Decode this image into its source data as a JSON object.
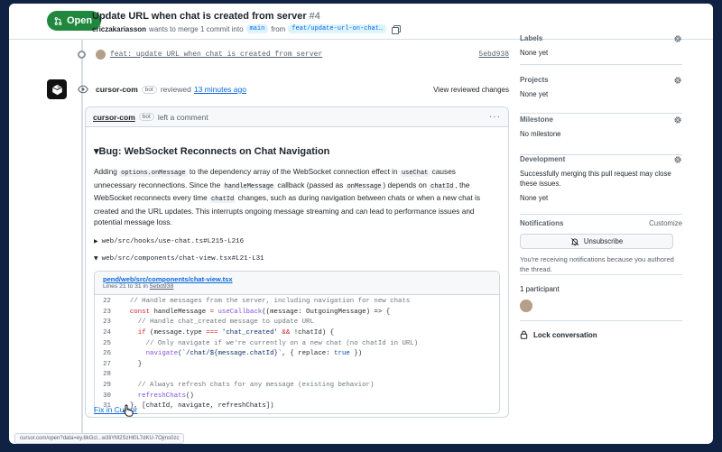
{
  "header": {
    "status_label": "Open",
    "title": "Update URL when chat is created from server",
    "number": "#4",
    "author": "ericzakariasson",
    "merge_text": "wants to merge 1 commit into",
    "base_branch": "main",
    "from_text": "from",
    "head_branch": "feat/update-url-on-chat…"
  },
  "timeline": {
    "commit": {
      "message": "feat: update URL when chat is created from server",
      "sha": "5ebd938"
    },
    "review": {
      "author": "cursor-com",
      "bot_tag": "bot",
      "action": "reviewed",
      "time": "13 minutes ago",
      "view_reviewed": "View reviewed changes"
    }
  },
  "comment": {
    "author": "cursor-com",
    "bot_tag": "bot",
    "action": "left a comment",
    "menu": "···",
    "bug_title": "▾Bug: WebSocket Reconnects on Chat Navigation",
    "para": {
      "t1": "Adding ",
      "c1": "options.onMessage",
      "t2": " to the dependency array of the WebSocket connection effect in ",
      "c2": "useChat",
      "t3": " causes unnecessary reconnections. Since the ",
      "c3": "handleMessage",
      "t4": " callback (passed as ",
      "c4": "onMessage",
      "t5": ") depends on ",
      "c5": "chatId",
      "t6": ", the WebSocket reconnects every time ",
      "c6": "chatId",
      "t7": " changes, such as during navigation between chats or when a new chat is created and the URL updates. This interrupts ongoing message streaming and can lead to performance issues and potential message loss."
    },
    "details_1": "web/src/hooks/use-chat.ts#L215-L216",
    "details_2": "web/src/components/chat-view.tsx#L21-L31",
    "snippet": {
      "file": "pend/web/src/components/chat-view.tsx",
      "lines_text": "Lines 21 to 31 in ",
      "lines_sha": "5ebd938"
    },
    "fix_link": "Fix in Cursor"
  },
  "code_lines": [
    {
      "n": "22",
      "parts": [
        [
          "cm",
          "  // Handle messages from the server, including navigation for new chats"
        ]
      ]
    },
    {
      "n": "23",
      "parts": [
        [
          "kw",
          "  const "
        ],
        [
          "src",
          "handleMessage "
        ],
        [
          "kw",
          "= "
        ],
        [
          "fn",
          "useCallback"
        ],
        [
          "src",
          "((message: OutgoingMessage) => {"
        ]
      ]
    },
    {
      "n": "23",
      "parts": [
        [
          "cm",
          "    // Handle chat_created message to update URL"
        ]
      ]
    },
    {
      "n": "24",
      "parts": [
        [
          "kw",
          "    if "
        ],
        [
          "src",
          "(message.type "
        ],
        [
          "kw",
          "=== "
        ],
        [
          "st",
          "'chat_created' "
        ],
        [
          "kw",
          "&& "
        ],
        [
          "src",
          "!chatId) {"
        ]
      ]
    },
    {
      "n": "25",
      "parts": [
        [
          "cm",
          "      // Only navigate if we're currently on a new chat (no chatId in URL)"
        ]
      ]
    },
    {
      "n": "26",
      "parts": [
        [
          "fn",
          "      navigate"
        ],
        [
          "st",
          "(`/chat/${message.chatId}`"
        ],
        [
          "src",
          ", { replace: "
        ],
        [
          "cn",
          "true"
        ],
        [
          "src",
          " })"
        ]
      ]
    },
    {
      "n": "27",
      "parts": [
        [
          "src",
          "    }"
        ]
      ]
    },
    {
      "n": "28",
      "parts": [
        [
          "src",
          ""
        ]
      ]
    },
    {
      "n": "29",
      "parts": [
        [
          "cm",
          "    // Always refresh chats for any message (existing behavior)"
        ]
      ]
    },
    {
      "n": "30",
      "parts": [
        [
          "fn",
          "    refreshChats"
        ],
        [
          "src",
          "()"
        ]
      ]
    },
    {
      "n": "31",
      "parts": [
        [
          "src",
          "  }, [chatId, navigate, refreshChats])"
        ]
      ]
    }
  ],
  "sidebar": {
    "labels_title": "Labels",
    "labels_value": "None yet",
    "projects_title": "Projects",
    "projects_value": "None yet",
    "milestone_title": "Milestone",
    "milestone_value": "No milestone",
    "development_title": "Development",
    "development_desc": "Successfully merging this pull request may close these issues.",
    "development_value": "None yet",
    "notifications_title": "Notifications",
    "customize": "Customize",
    "unsubscribe": "Unsubscribe",
    "notifications_note": "You're receiving notifications because you authored the thread.",
    "participants_title": "1 participant",
    "lock": "Lock conversation"
  },
  "status_url": "cursor.com/open?data=ey.8kGcl...w3liYM2SzHl0L7dKU-7Ojms0zc"
}
